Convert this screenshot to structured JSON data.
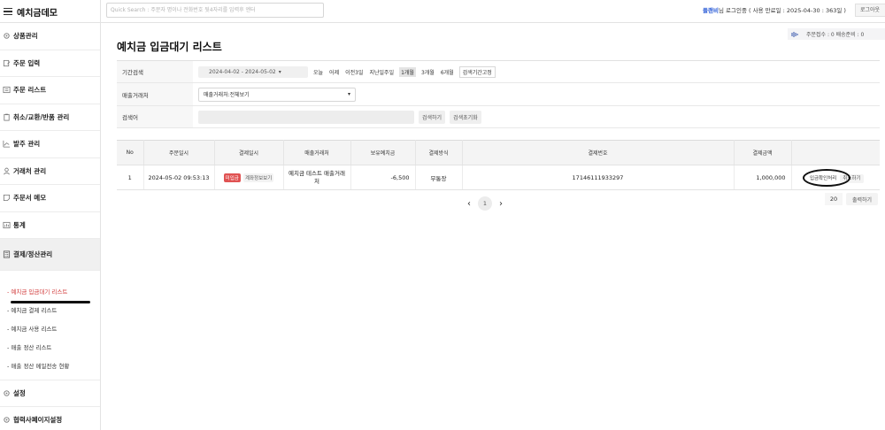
{
  "app": {
    "title": "예치금데모"
  },
  "search": {
    "placeholder": "Quick Search : 주문자 명이나 전화번호 뒷4자리를 입력후 엔터"
  },
  "header": {
    "user": "플랜비",
    "login_text": "님 로그인중 ( 사용 만료일 : 2025-04-30 : 363일 )",
    "logout": "로그아웃"
  },
  "sidebar": {
    "items": [
      {
        "label": "상품관리",
        "icon": "gear-icon"
      },
      {
        "label": "주문 입력",
        "icon": "edit-icon"
      },
      {
        "label": "주문 리스트",
        "icon": "list-icon"
      },
      {
        "label": "취소/교환/반품 관리",
        "icon": "clipboard-icon"
      },
      {
        "label": "발주 관리",
        "icon": "chart-icon"
      },
      {
        "label": "거래처 관리",
        "icon": "user-icon"
      },
      {
        "label": "주문서 메모",
        "icon": "memo-icon"
      },
      {
        "label": "통계",
        "icon": "stats-icon"
      },
      {
        "label": "결제/정산관리",
        "icon": "calculator-icon"
      }
    ],
    "submenu": [
      "- 예치금 입금대기 리스트",
      "- 예치금 결제 리스트",
      "- 예치금 사용 리스트",
      "- 매출 정산 리스트",
      "- 매출 정산 메일전송 현황"
    ],
    "bottom_items": [
      {
        "label": "설정",
        "icon": "gear-icon"
      },
      {
        "label": "협력사페이지설정",
        "icon": "gear-icon"
      }
    ]
  },
  "status": {
    "text": "주문접수 : 0   배송준비 : 0"
  },
  "page": {
    "title": "예치금 입금대기 리스트"
  },
  "filter": {
    "period_label": "기간검색",
    "date_range": "2024-04-02 - 2024-05-02",
    "period_buttons": [
      "오늘",
      "어제",
      "이전3일",
      "지난일주일",
      "1개월",
      "3개월",
      "6개월"
    ],
    "period_selected": "1개월",
    "period_reset": "검색기간고정",
    "client_label": "매출거래처",
    "client_value": "매출거래처:전체보기",
    "keyword_label": "검색어",
    "search_btn": "검색하기",
    "reset_btn": "검색초기화"
  },
  "table": {
    "headers": [
      "No",
      "주문일시",
      "결제일시",
      "매출거래처",
      "보유예치금",
      "결제방식",
      "결제번호",
      "결제금액",
      ""
    ],
    "rows": [
      {
        "no": "1",
        "order_date": "2024-05-02 09:53:13",
        "pay_badge": "미입금",
        "pay_info_btn": "계좌정보보기",
        "client": "예치금 테스트 매출거래처",
        "balance": "-6,500",
        "method": "무통장",
        "pay_no": "17146111933297",
        "amount": "1,000,000",
        "confirm_btn": "입금확인처리",
        "cancel_btn": "취소하기"
      }
    ]
  },
  "pager": {
    "prev": "‹",
    "current": "1",
    "next": "›",
    "per_page": "20",
    "print": "출력하기"
  }
}
